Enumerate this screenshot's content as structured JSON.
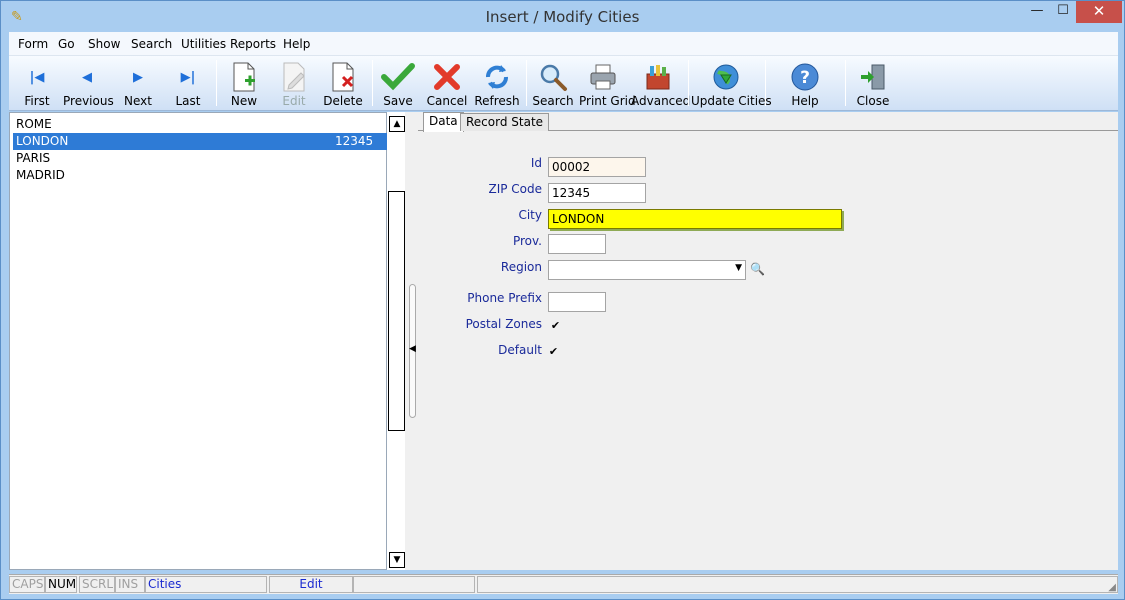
{
  "window": {
    "title": "Insert / Modify Cities",
    "minimize": "—",
    "maximize": "☐",
    "close": "✕"
  },
  "menu": [
    "Form",
    "Go",
    "Show",
    "Search",
    "Utilities",
    "Reports",
    "Help"
  ],
  "toolbar": {
    "first": "First",
    "previous": "Previous",
    "next": "Next",
    "last": "Last",
    "new": "New",
    "edit": "Edit",
    "delete": "Delete",
    "save": "Save",
    "cancel": "Cancel",
    "refresh": "Refresh",
    "search": "Search",
    "print_grid": "Print Grid",
    "advanced": "Advanced",
    "update_cities": "Update Cities",
    "help": "Help",
    "close": "Close"
  },
  "list": {
    "items": [
      {
        "name": "ROME",
        "zip": ""
      },
      {
        "name": "LONDON",
        "zip": "12345"
      },
      {
        "name": "PARIS",
        "zip": ""
      },
      {
        "name": "MADRID",
        "zip": ""
      }
    ]
  },
  "tabs": {
    "data": "Data",
    "record_state": "Record State"
  },
  "form": {
    "id_label": "Id",
    "id_value": "00002",
    "zip_label": "ZIP Code",
    "zip_value": "12345",
    "city_label": "City",
    "city_value": "LONDON",
    "prov_label": "Prov.",
    "prov_value": "",
    "region_label": "Region",
    "region_value": "",
    "phone_label": "Phone Prefix",
    "phone_value": "",
    "postal_label": "Postal Zones",
    "postal_checked": "✔",
    "default_label": "Default",
    "default_checked": "✔"
  },
  "status": {
    "caps": "CAPS",
    "num": "NUM",
    "scrl": "SCRL",
    "ins": "INS",
    "table": "Cities",
    "mode": "Edit"
  },
  "colors": {
    "accent": "#2e7bd6",
    "highlight": "#ffff00",
    "label": "#1a2a9a"
  }
}
